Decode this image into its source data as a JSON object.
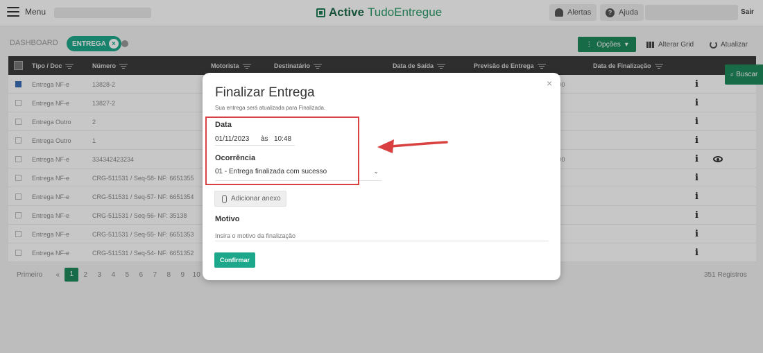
{
  "topbar": {
    "menu_label": "Menu",
    "logo_brand": "Active",
    "logo_product": "TudoEntregue",
    "alerts_label": "Alertas",
    "help_label": "Ajuda",
    "exit_label": "Sair"
  },
  "breadcrumb": {
    "dashboard": "DASHBOARD",
    "current": "ENTREGA"
  },
  "toolbar": {
    "options_label": "Opções",
    "grid_label": "Alterar Grid",
    "refresh_label": "Atualizar",
    "search_label": "Buscar"
  },
  "table": {
    "columns": [
      "Tipo / Doc",
      "Número",
      "Motorista",
      "Destinatário",
      "Data de Saída",
      "Previsão de Entrega",
      "Data de Finalização"
    ],
    "rows": [
      {
        "tipo": "Entrega NF-e",
        "numero": "13828-2",
        "extra": ":00",
        "checked": true
      },
      {
        "tipo": "Entrega NF-e",
        "numero": "13827-2",
        "extra": ""
      },
      {
        "tipo": "Entrega Outro",
        "numero": "2",
        "extra": ""
      },
      {
        "tipo": "Entrega Outro",
        "numero": "1",
        "extra": ""
      },
      {
        "tipo": "Entrega NF-e",
        "numero": "334342423234",
        "extra": ":00"
      },
      {
        "tipo": "Entrega NF-e",
        "numero": "CRG-511531 / Seq-58- NF: 6651355",
        "extra": ""
      },
      {
        "tipo": "Entrega NF-e",
        "numero": "CRG-511531 / Seq-57- NF: 6651354",
        "extra": ""
      },
      {
        "tipo": "Entrega NF-e",
        "numero": "CRG-511531 / Seq-56- NF: 35138",
        "extra": ""
      },
      {
        "tipo": "Entrega NF-e",
        "numero": "CRG-511531 / Seq-55- NF: 6651353",
        "extra": ""
      },
      {
        "tipo": "Entrega NF-e",
        "numero": "CRG-511531 / Seq-54- NF: 6651352",
        "extra": ""
      }
    ]
  },
  "pager": {
    "first_label": "Primeiro",
    "prev_label": "«",
    "pages": [
      "1",
      "2",
      "3",
      "4",
      "5",
      "6",
      "7",
      "8",
      "9",
      "10"
    ],
    "active_page": "1",
    "records_label": "351 Registros"
  },
  "modal": {
    "title": "Finalizar Entrega",
    "subtitle": "Sua entrega será atualizada para Finalizada.",
    "close_label": "×",
    "date_label": "Data",
    "date_value": "01/11/2023",
    "at_label": "às",
    "time_value": "10:48",
    "occurrence_label": "Ocorrência",
    "occurrence_value": "01 - Entrega finalizada com sucesso",
    "attach_label": "Adicionar anexo",
    "reason_label": "Motivo",
    "reason_placeholder": "Insira o motivo da finalização",
    "confirm_label": "Confirmar"
  },
  "colors": {
    "accent_green": "#1f8a5c",
    "teal": "#1ea88b",
    "highlight_red": "#d94040"
  }
}
